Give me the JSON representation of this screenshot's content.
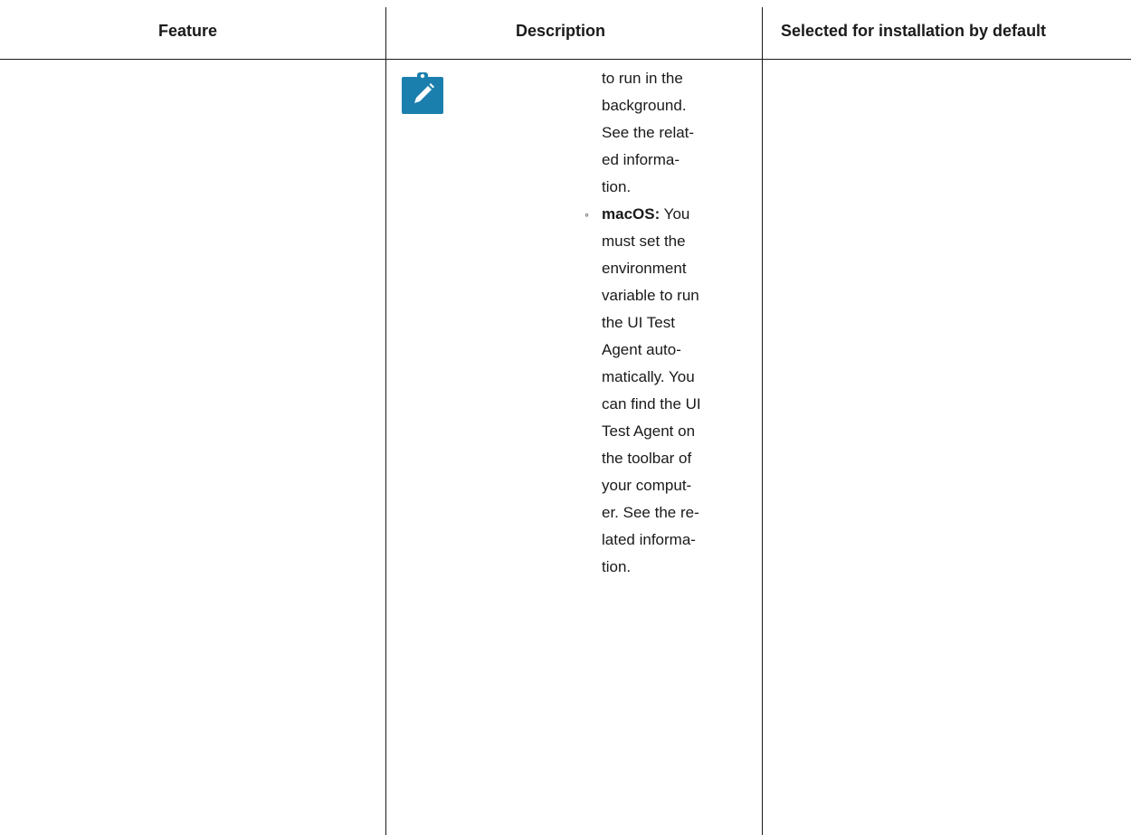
{
  "table": {
    "headers": {
      "feature": "Feature",
      "description": "Description",
      "selected": "Selected for installation by default"
    }
  },
  "note": {
    "icon": "note-pencil-icon",
    "icon_color": "#1b7fae",
    "lines_before": [
      "to run in the",
      "background.",
      "See the relat-",
      "ed informa-",
      "tion."
    ],
    "bullet_symbol": "◦",
    "bullet_label": "macOS:",
    "bullet_first_line": " You",
    "bullet_lines": [
      "must set the",
      "environment",
      "variable to run",
      "the UI Test",
      "Agent auto-",
      "matically. You",
      "can find the UI",
      "Test Agent on",
      "the toolbar of",
      "your comput-",
      "er. See the re-",
      "lated informa-",
      "tion."
    ]
  }
}
